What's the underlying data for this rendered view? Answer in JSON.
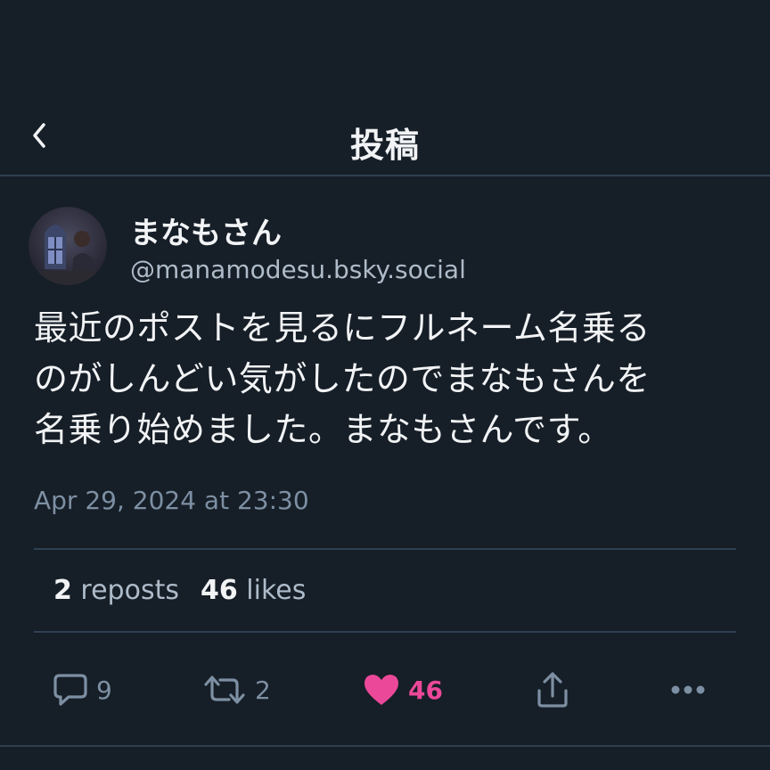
{
  "header": {
    "title": "投稿",
    "back_icon": "chevron-left-icon"
  },
  "author": {
    "display_name": "まなもさん",
    "handle": "@manamodesu.bsky.social"
  },
  "post": {
    "text_lines": [
      "最近のポストを見るにフルネーム名乗る",
      "のがしんどい気がしたのでまなもさんを",
      "名乗り始めました。まなもさんです。"
    ],
    "timestamp": "Apr 29, 2024 at 23:30"
  },
  "stats": {
    "reposts_count": "2",
    "reposts_label": "reposts",
    "likes_count": "46",
    "likes_label": "likes"
  },
  "actions": {
    "reply_count": "9",
    "repost_count": "2",
    "like_count": "46",
    "share_icon": "share-icon",
    "more_icon": "more-horizontal-icon"
  },
  "colors": {
    "background": "#161e27",
    "text": "#f1f3f5",
    "muted": "#7d8fa3",
    "like_accent": "#ec4899",
    "divider": "#2e4052"
  }
}
